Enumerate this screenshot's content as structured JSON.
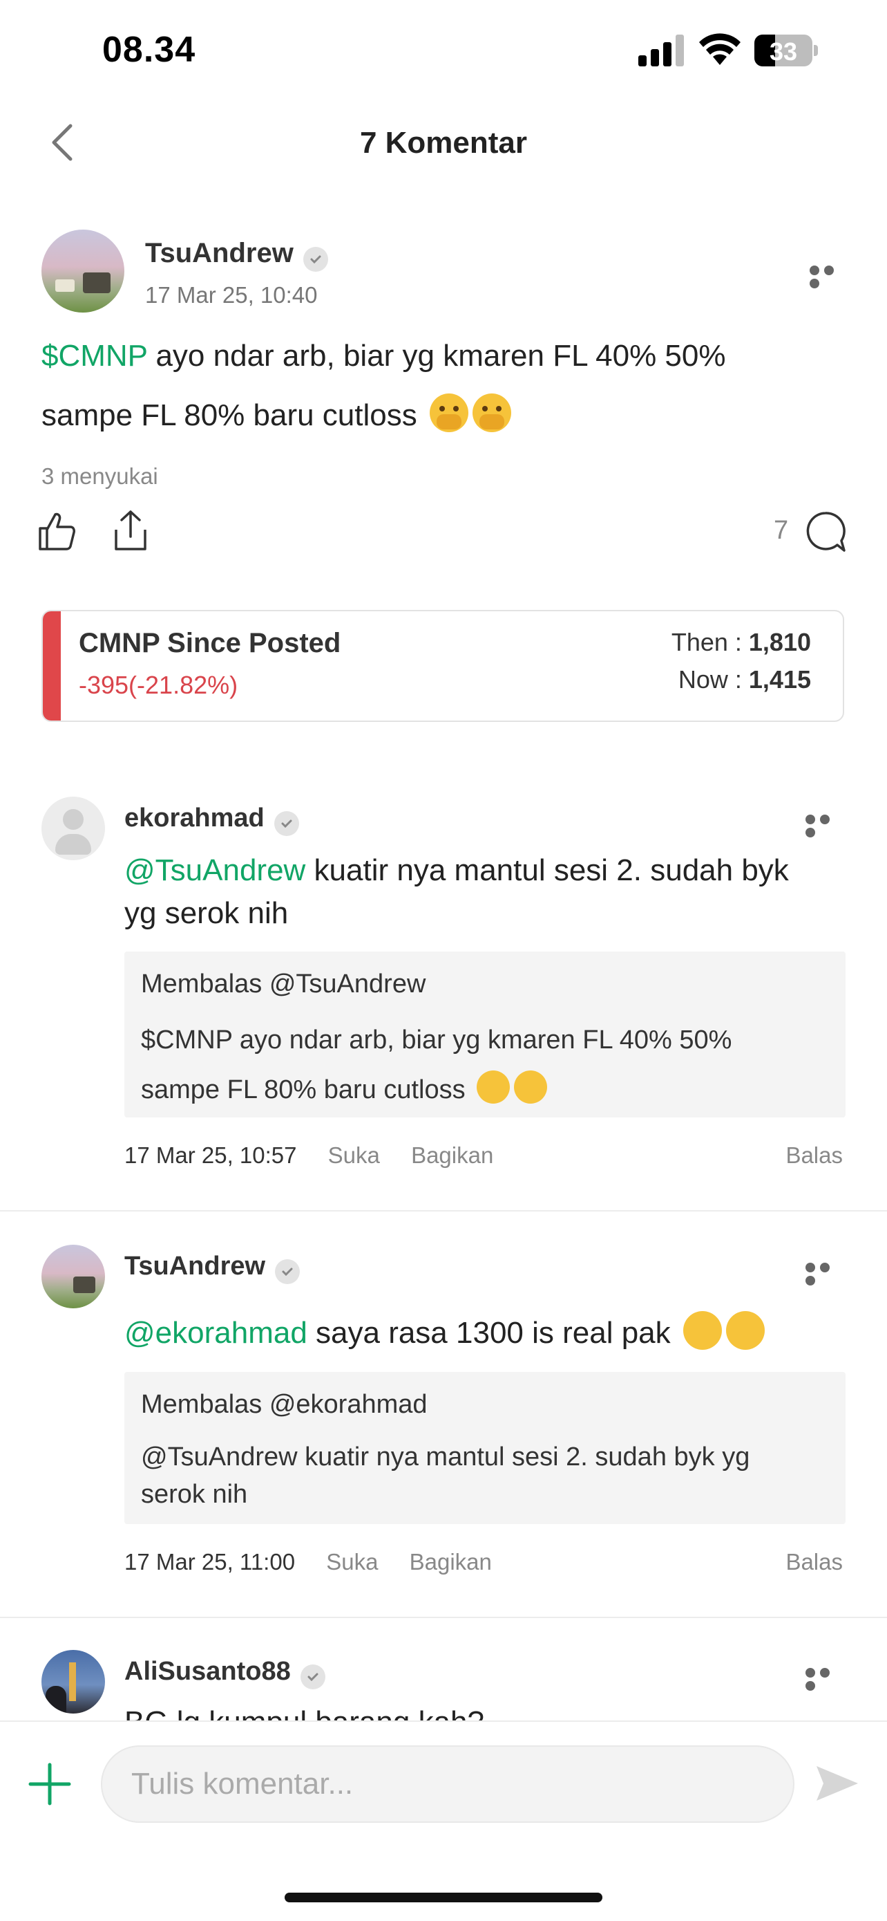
{
  "status_bar": {
    "time": "08.34",
    "battery": "33"
  },
  "header": {
    "title": "7 Komentar"
  },
  "post": {
    "author": "TsuAndrew",
    "timestamp": "17 Mar 25, 10:40",
    "ticker": "$CMNP",
    "text_line1": " ayo ndar arb, biar yg kmaren FL 40% 50%",
    "text_line2": "sampe FL 80% baru cutloss",
    "likes_text": "3 menyukai",
    "comment_count": "7"
  },
  "price_card": {
    "title": "CMNP Since Posted",
    "change": "-395(-21.82%)",
    "then_label": "Then : ",
    "then_value": "1,810",
    "now_label": "Now : ",
    "now_value": "1,415",
    "accent": "#e0474a"
  },
  "comments": [
    {
      "author": "ekorahmad",
      "mention": "@TsuAndrew",
      "text_line1": " kuatir nya mantul sesi 2. sudah byk",
      "text_line2": "yg serok nih",
      "reply_head": "Membalas @TsuAndrew",
      "reply_line1": "$CMNP ayo ndar arb, biar yg kmaren FL 40% 50%",
      "reply_line2": "sampe FL 80% baru cutloss",
      "timestamp": "17 Mar 25, 10:57",
      "like": "Suka",
      "share": "Bagikan",
      "reply": "Balas"
    },
    {
      "author": "TsuAndrew",
      "mention": "@ekorahmad",
      "text_line1": " saya rasa 1300 is real pak",
      "reply_head": "Membalas @ekorahmad",
      "reply_line1": "@TsuAndrew kuatir nya mantul sesi 2. sudah byk yg",
      "reply_line2": "serok nih",
      "timestamp": "17 Mar 25, 11:00",
      "like": "Suka",
      "share": "Bagikan",
      "reply": "Balas"
    },
    {
      "author": "AliSusanto88",
      "text_line1": "BG lg kumpul barang kah?"
    }
  ],
  "composer": {
    "placeholder": "Tulis komentar..."
  },
  "colors": {
    "brand_green": "#11a566",
    "loss_red": "#d9444b"
  }
}
